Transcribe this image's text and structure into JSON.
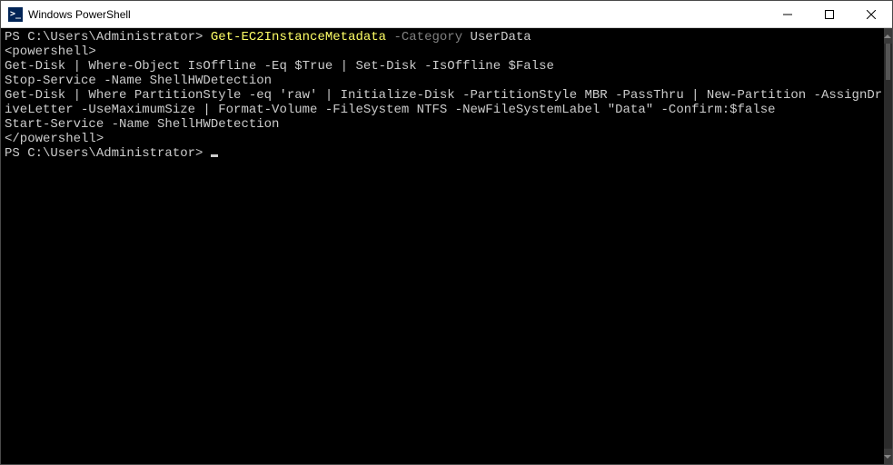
{
  "window": {
    "title": "Windows PowerShell",
    "icon_glyph": ">_"
  },
  "terminal": {
    "prompt1": "PS C:\\Users\\Administrator> ",
    "cmd": "Get-EC2InstanceMetadata",
    "param": " -Category",
    "arg": " UserData",
    "output_lines": [
      "<powershell>",
      "Get-Disk | Where-Object IsOffline -Eq $True | Set-Disk -IsOffline $False",
      "Stop-Service -Name ShellHWDetection",
      "Get-Disk | Where PartitionStyle -eq 'raw' | Initialize-Disk -PartitionStyle MBR -PassThru | New-Partition -AssignDriveLetter -UseMaximumSize | Format-Volume -FileSystem NTFS -NewFileSystemLabel \"Data\" -Confirm:$false",
      "Start-Service -Name ShellHWDetection",
      "</powershell>"
    ],
    "prompt2": "PS C:\\Users\\Administrator> "
  }
}
